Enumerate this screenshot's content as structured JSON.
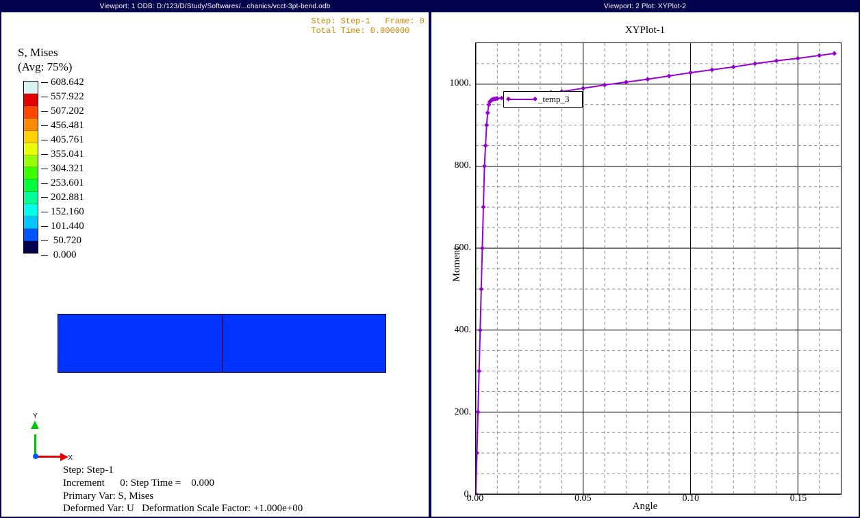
{
  "viewport1": {
    "header": "Viewport: 1     ODB: D:/123/D/Study/Softwares/...chanics/vcct-3pt-bend.odb",
    "step_info_line1": "Step: Step-1   Frame: 0",
    "step_info_line2": "Total Time: 0.000000",
    "field_title": "S, Mises",
    "field_avg": "(Avg: 75%)",
    "legend_values": [
      "608.642",
      "557.922",
      "507.202",
      "456.481",
      "405.761",
      "355.041",
      "304.321",
      "253.601",
      "202.881",
      "152.160",
      "101.440",
      " 50.720",
      "  0.000"
    ],
    "legend_colors": [
      "#d9f2f2",
      "#e20000",
      "#ff4600",
      "#ff8c00",
      "#ffd200",
      "#e8ff00",
      "#96ff00",
      "#3cff00",
      "#00ff3c",
      "#00ff96",
      "#00ffe8",
      "#00c8ff",
      "#0055ff",
      "#02024e"
    ],
    "triad_y": "Y",
    "triad_x": "X",
    "bottom_line1": "Step: Step-1",
    "bottom_line2": "Increment      0: Step Time =    0.000",
    "bottom_line3": "Primary Var: S, Mises",
    "bottom_line4": "Deformed Var: U   Deformation Scale Factor: +1.000e+00"
  },
  "viewport2": {
    "header": "Viewport: 2     Plot: XYPlot-2",
    "title": "XYPlot-1",
    "ylabel": "Moment",
    "xlabel": "Angle",
    "legend_label": "_temp_3",
    "y_ticks": [
      "0.",
      "200.",
      "400.",
      "600.",
      "800.",
      "1000."
    ],
    "x_ticks": [
      "0.00",
      "0.05",
      "0.10",
      "0.15"
    ]
  },
  "chart_data": {
    "type": "line",
    "title": "XYPlot-1",
    "xlabel": "Angle",
    "ylabel": "Moment",
    "xlim": [
      0,
      0.17
    ],
    "ylim": [
      0,
      1100
    ],
    "series": [
      {
        "name": "_temp_3",
        "color": "#9400d3",
        "x": [
          0.0,
          0.0005,
          0.001,
          0.0015,
          0.002,
          0.0025,
          0.003,
          0.0035,
          0.004,
          0.0045,
          0.005,
          0.0055,
          0.006,
          0.0065,
          0.007,
          0.0075,
          0.008,
          0.0085,
          0.009,
          0.0095,
          0.01,
          0.012,
          0.014,
          0.016,
          0.018,
          0.02,
          0.025,
          0.03,
          0.035,
          0.04,
          0.05,
          0.06,
          0.07,
          0.08,
          0.09,
          0.1,
          0.11,
          0.12,
          0.13,
          0.14,
          0.15,
          0.16,
          0.167
        ],
        "y": [
          0,
          100,
          200,
          300,
          400,
          500,
          600,
          700,
          800,
          850,
          900,
          930,
          950,
          957,
          960,
          962,
          963,
          964,
          964,
          965,
          965,
          966,
          967,
          968,
          969,
          970,
          975,
          978,
          980,
          982,
          990,
          998,
          1005,
          1012,
          1020,
          1028,
          1035,
          1042,
          1050,
          1057,
          1063,
          1070,
          1075
        ]
      }
    ],
    "grid": {
      "major": true,
      "minor": true
    }
  }
}
